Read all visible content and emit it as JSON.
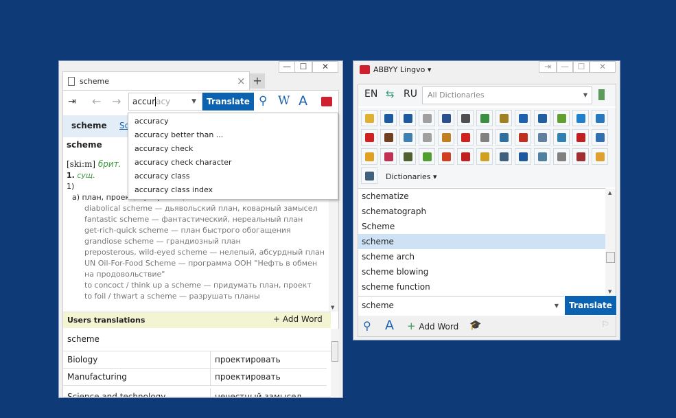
{
  "left": {
    "tab_title": "scheme",
    "tab_close": "×",
    "new_tab": "+",
    "win_min": "—",
    "win_max": "☐",
    "win_close": "✕",
    "search_value_typed": "accur",
    "search_value_completion": "acy",
    "translate_label": "Translate",
    "tool_icons": [
      "search-icon",
      "wikipedia-icon",
      "font-icon",
      "lingvo-logo-icon"
    ],
    "card_tabs": [
      "scheme",
      "Sc"
    ],
    "suggestions": [
      "accuracy",
      "accuracy better than ...",
      "accuracy check",
      "accuracy check character",
      "accuracy class",
      "accuracy class index"
    ],
    "headword": "scheme",
    "transcription": "[ski:m]",
    "region": "брит.",
    "pos_num": "1.",
    "pos": "сущ.",
    "sense": "1)",
    "meaning": "а) план, проект, программа, схема",
    "examples": [
      "diabolical scheme — дьявольский план, коварный замысел",
      "fantastic scheme — фантастический, нереальный план",
      "get-rich-quick scheme — план быстрого обогащения",
      "grandiose scheme — грандиозный план",
      "preposterous, wild-eyed scheme — нелепый, абсурдный план",
      "UN Oil-For-Food Scheme — программа ООН \"Нефть в обмен",
      "на продовольствие\"",
      "to concoct / think up a scheme — придумать план, проект",
      "to foil / thwart a scheme — разрушать планы"
    ],
    "users_translations": "Users translations",
    "add_word": "Add Word",
    "ut_word": "scheme",
    "ut_rows": [
      [
        "Biology",
        "проектировать"
      ],
      [
        "Manufacturing",
        "проектировать"
      ],
      [
        "Science and technology",
        "нечестный замысел"
      ]
    ]
  },
  "right": {
    "title": "ABBYY Lingvo ▾",
    "pin": "⇥",
    "win_min": "—",
    "win_max": "☐",
    "win_close": "✕",
    "src_lang": "EN",
    "dst_lang": "RU",
    "dictionary_select": "All Dictionaries",
    "dictionaries_label": "Dictionaries ▾",
    "dict_colors": [
      "#e0b030",
      "#1e5aa0",
      "#1e5aa0",
      "#a0a0a0",
      "#2a5090",
      "#505050",
      "#3a9040",
      "#a08020",
      "#2060b0",
      "#2060a0",
      "#60a030",
      "#2080d0",
      "#2878c0",
      "#d02020",
      "#704020",
      "#4080b0",
      "#a0a0a0",
      "#c08020",
      "#d02020",
      "#808080",
      "#3070a0",
      "#c03020",
      "#6080a0",
      "#3080b0",
      "#c02020",
      "#3070b0",
      "#e0a020",
      "#c03050",
      "#506030",
      "#50a030",
      "#d04020",
      "#c02020",
      "#d0a020",
      "#406080",
      "#1e5aa0",
      "#5080a0",
      "#808080",
      "#a03030",
      "#e0a030",
      "#406080"
    ],
    "word_list": [
      "schematize",
      "schematograph",
      "Scheme",
      "scheme",
      "scheme arch",
      "scheme blowing",
      "scheme function"
    ],
    "selected_index": 3,
    "input_value": "scheme",
    "translate_label": "Translate",
    "add_word": "Add Word"
  },
  "colors": {
    "accent": "#0a62b0",
    "background": "#0e3a78",
    "highlight": "#cde3f5",
    "users_bar": "#f2f4d2"
  }
}
